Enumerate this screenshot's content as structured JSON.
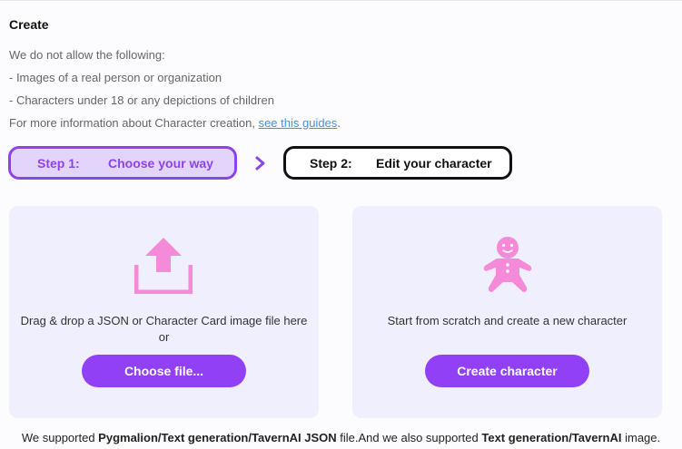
{
  "page": {
    "title": "Create",
    "rules": {
      "intro": "We do not allow the following:",
      "item1": "- Images of a real person or organization",
      "item2": "- Characters under 18 or any depictions of children",
      "more_prefix": "For more information about Character creation, ",
      "more_link": "see this guides",
      "more_suffix": "."
    }
  },
  "steps": [
    {
      "num": "Step 1:",
      "label": "Choose your way",
      "active": true
    },
    {
      "num": "Step 2:",
      "label": "Edit your character",
      "active": false
    }
  ],
  "upload_card": {
    "icon": "upload-icon",
    "line1": "Drag & drop a JSON or Character Card image file here",
    "line2": "or",
    "button": "Choose file..."
  },
  "create_card": {
    "icon": "gingerbread-icon",
    "text": "Start from scratch and create a new character",
    "button": "Create character"
  },
  "footer": {
    "part1": "We supported ",
    "bold1": "Pygmalion/Text generation/TavernAI JSON",
    "part2": " file.And we also supported ",
    "bold2": "Text generation/TavernAI",
    "part3": " image."
  },
  "colors": {
    "accent": "#9140f5",
    "step_active_bg": "#e3d4fb",
    "icon_pink": "#f58ad8",
    "card_bg": "#efeffd",
    "link": "#4a90e2"
  }
}
